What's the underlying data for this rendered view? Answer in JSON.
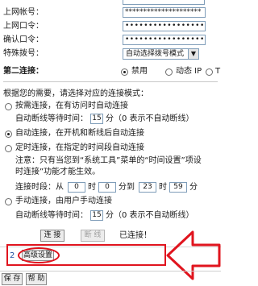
{
  "fields": {
    "account_label": "上网帐号：",
    "account_value": "*********************",
    "password_label": "上网口令：",
    "password_value": "•••••••••••••••••",
    "confirm_label": "确认口令：",
    "confirm_value": "•••••••••••••••••",
    "dialmode_label": "特殊拨号：",
    "dialmode_value": "自动选择拨号模式"
  },
  "secondary": {
    "label": "第二连接：",
    "opt1": "禁用",
    "opt2": "动态 IP",
    "opt3": "T"
  },
  "connect_mode": {
    "intro": "根据您的需要，请选择对应的连接模式：",
    "on_demand": "按需连接，在有访问时自动连接",
    "on_demand_idle_prefix": "自动断线等待时间：",
    "on_demand_idle_value": "15",
    "on_demand_idle_suffix": "分（0 表示不自动断线）",
    "auto": "自动连接，在开机和断线后自动连接",
    "scheduled": "定时连接，在指定的时间段自动连接",
    "note_line1": "注意：只有当您到“系统工具”菜单的“时间设置”项设",
    "note_line2": "时连接”功能才能生效。",
    "time_prefix": "连接时段：从",
    "time_from_h": "0",
    "time_sep1": "时",
    "time_from_m": "0",
    "time_sep2": "分到",
    "time_to_h": "23",
    "time_sep3": "时",
    "time_to_m": "59",
    "time_sep4": "分",
    "manual": "手动连接，由用户手动连接",
    "manual_idle_prefix": "自动断线等待时间：",
    "manual_idle_value": "15",
    "manual_idle_suffix": "分（0 表示不自动断线）"
  },
  "actions": {
    "connect": "连 接",
    "disconnect": "断 线",
    "status": "已连接！"
  },
  "advanced": {
    "step_number": "2",
    "button_label": "高级设置"
  },
  "footer": {
    "save": "保 存",
    "help": "帮 助"
  },
  "colors": {
    "annotation_red": "#e0141e",
    "step_blue": "#1f4fa0"
  }
}
